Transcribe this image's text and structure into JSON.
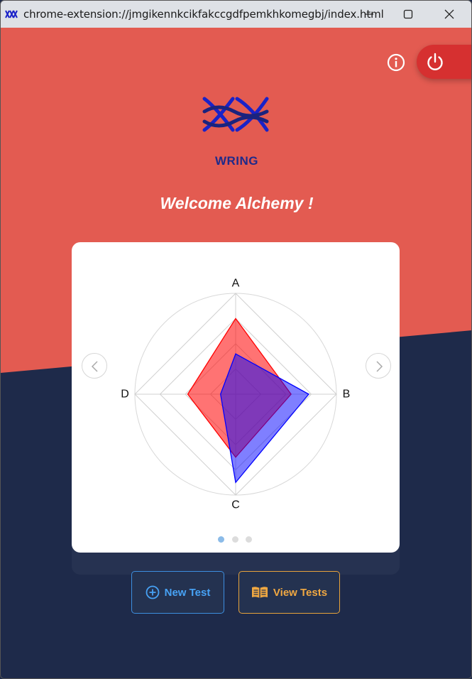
{
  "window": {
    "title": "chrome-extension://jmgikennkcikfakccgdfpemkhkomegbj/index.html"
  },
  "header": {
    "info_icon": "info-icon",
    "power_icon": "power-icon"
  },
  "brand": {
    "name": "WRING",
    "logo_color": "#1a22c8"
  },
  "welcome": "Welcome Alchemy !",
  "colors": {
    "top_background": "#e35b51",
    "bottom_background": "#1e2a4a",
    "power_button": "#d63030",
    "series_red": "#ff0000",
    "series_blue": "#0000ff"
  },
  "chart_data": {
    "type": "radar",
    "axes": [
      "A",
      "B",
      "C",
      "D"
    ],
    "max": 4,
    "rings": 4,
    "series": [
      {
        "values": [
          3.0,
          2.2,
          2.5,
          1.9
        ],
        "color": "#ff0000"
      },
      {
        "values": [
          1.6,
          2.9,
          3.5,
          0.6
        ],
        "color": "#0000ff"
      }
    ]
  },
  "carousel": {
    "pages": 3,
    "active": 0
  },
  "buttons": {
    "new_test": "New Test",
    "view_tests": "View Tests"
  }
}
